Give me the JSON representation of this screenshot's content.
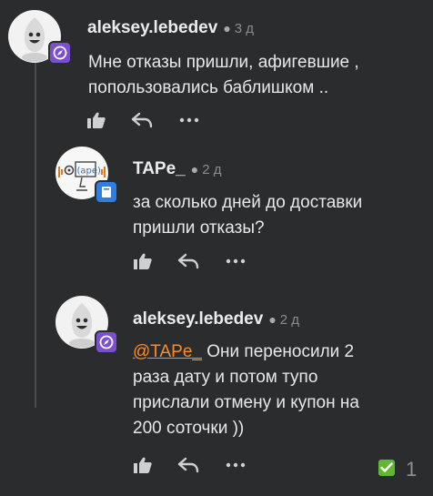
{
  "comments": [
    {
      "author": "aleksey.lebedev",
      "time": "3 д",
      "text": "Мне отказы пришли, афигевшие , попользовались баблишком ..",
      "avatar": "ghost-avatar-icon",
      "badge": "compass-badge-icon"
    },
    {
      "author": "TAPe_",
      "time": "2 д",
      "text": "за сколько дней до доставки пришли отказы?",
      "avatar": "tape-logo-avatar",
      "badge": "book-badge-icon"
    },
    {
      "author": "aleksey.lebedev",
      "time": "2 д",
      "mention": "@TAPe_",
      "text": " Они переносили 2 раза дату и потом тупо прислали отмену и купон на 200 соточки ))",
      "avatar": "ghost-avatar-icon",
      "badge": "compass-badge-icon"
    }
  ],
  "vote_count": "1",
  "colors": {
    "background": "#2b2c2e",
    "mention": "#ff8a2a",
    "badge_purple": "#7b4fd0",
    "badge_blue": "#2f7fe0",
    "check_green": "#5fb82e"
  }
}
